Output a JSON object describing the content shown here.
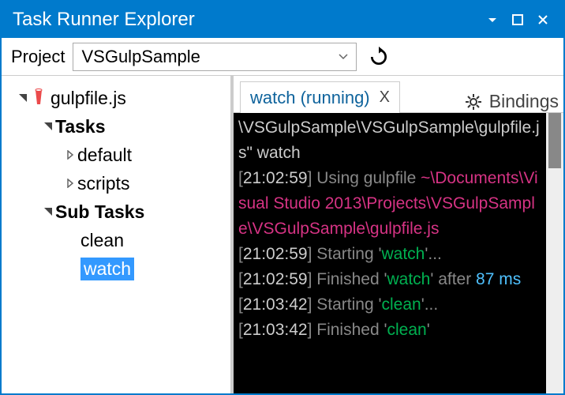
{
  "titlebar": {
    "title": "Task Runner Explorer"
  },
  "project": {
    "label": "Project",
    "selected": "VSGulpSample"
  },
  "tree": {
    "root": "gulpfile.js",
    "tasks_label": "Tasks",
    "tasks": [
      "default",
      "scripts"
    ],
    "subtasks_label": "Sub Tasks",
    "subtasks": [
      "clean",
      "watch"
    ],
    "selected": "watch"
  },
  "tabs": {
    "active": "watch (running)",
    "bindings": "Bindings"
  },
  "console": {
    "lines": [
      {
        "parts": [
          {
            "t": "\\VSGulpSample\\VSGulpSample\\gulpfile.js\" watch",
            "c": "c-w"
          }
        ]
      },
      {
        "parts": [
          {
            "t": "[",
            "c": ""
          },
          {
            "t": "21:02:59",
            "c": "c-w"
          },
          {
            "t": "] Using gulpfile ",
            "c": ""
          },
          {
            "t": "~\\Documents\\Visual Studio 2013\\Projects\\VSGulpSample\\VSGulpSample\\gulpfile.js",
            "c": "c-m"
          }
        ]
      },
      {
        "parts": [
          {
            "t": "[",
            "c": ""
          },
          {
            "t": "21:02:59",
            "c": "c-w"
          },
          {
            "t": "] Starting '",
            "c": ""
          },
          {
            "t": "watch",
            "c": "c-g"
          },
          {
            "t": "'...",
            "c": ""
          }
        ]
      },
      {
        "parts": [
          {
            "t": "[",
            "c": ""
          },
          {
            "t": "21:02:59",
            "c": "c-w"
          },
          {
            "t": "] Finished '",
            "c": ""
          },
          {
            "t": "watch",
            "c": "c-g"
          },
          {
            "t": "' after ",
            "c": ""
          },
          {
            "t": "87 ms",
            "c": "c-c"
          }
        ]
      },
      {
        "parts": [
          {
            "t": "[",
            "c": ""
          },
          {
            "t": "21:03:42",
            "c": "c-w"
          },
          {
            "t": "] Starting '",
            "c": ""
          },
          {
            "t": "clean",
            "c": "c-g"
          },
          {
            "t": "'...",
            "c": ""
          }
        ]
      },
      {
        "parts": [
          {
            "t": "[",
            "c": ""
          },
          {
            "t": "21:03:42",
            "c": "c-w"
          },
          {
            "t": "] Finished '",
            "c": ""
          },
          {
            "t": "clean",
            "c": "c-g"
          },
          {
            "t": "'",
            "c": ""
          }
        ]
      }
    ]
  }
}
